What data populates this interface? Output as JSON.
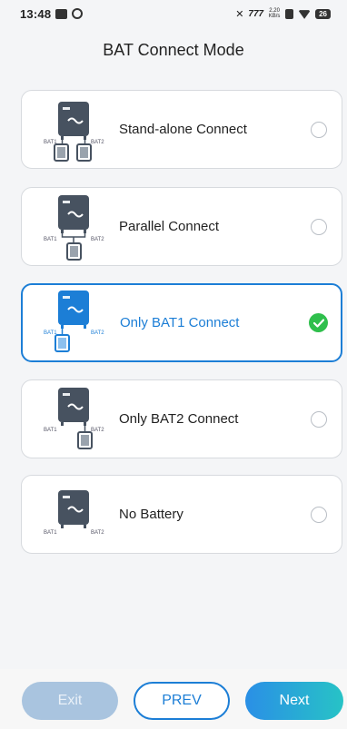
{
  "status_bar": {
    "time": "13:48",
    "network_speed": "2.20",
    "network_unit": "KB/s",
    "signal_text": "777",
    "battery": "26"
  },
  "header": {
    "title": "BAT Connect Mode"
  },
  "options": [
    {
      "label": "Stand-alone Connect",
      "selected": false,
      "icon": "inverter-two-batteries-standalone-icon"
    },
    {
      "label": "Parallel Connect",
      "selected": false,
      "icon": "inverter-batteries-parallel-icon"
    },
    {
      "label": "Only BAT1 Connect",
      "selected": true,
      "icon": "inverter-bat1-only-icon"
    },
    {
      "label": "Only BAT2 Connect",
      "selected": false,
      "icon": "inverter-bat2-only-icon"
    },
    {
      "label": "No Battery",
      "selected": false,
      "icon": "inverter-no-battery-icon"
    }
  ],
  "diagram_labels": {
    "bat1": "BAT1",
    "bat2": "BAT2"
  },
  "buttons": {
    "exit": "Exit",
    "prev": "PREV",
    "next": "Next"
  },
  "colors": {
    "accent": "#1c7ed6",
    "check": "#2fbf4c",
    "exit_disabled": "#a9c4df",
    "next_gradient_start": "#2a8fe6",
    "next_gradient_end": "#27c3c6"
  }
}
